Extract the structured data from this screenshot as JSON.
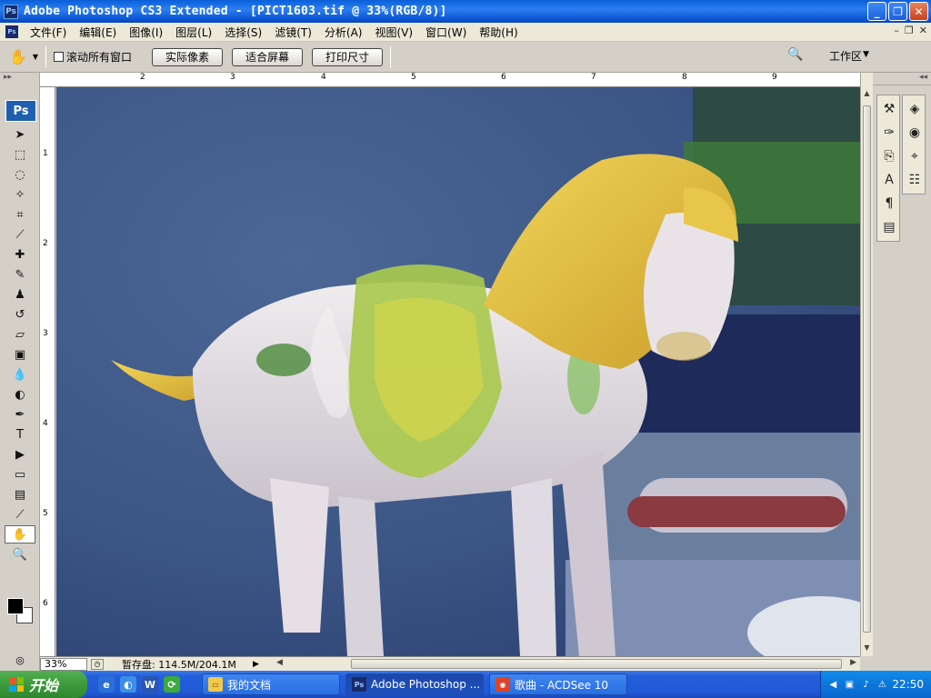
{
  "window": {
    "title": "Adobe Photoshop CS3 Extended - [PICT1603.tif @ 33%(RGB/8)]"
  },
  "menu": {
    "items": [
      "文件(F)",
      "编辑(E)",
      "图像(I)",
      "图层(L)",
      "选择(S)",
      "滤镜(T)",
      "分析(A)",
      "视图(V)",
      "窗口(W)",
      "帮助(H)"
    ]
  },
  "options": {
    "scroll_all_label": "滚动所有窗口",
    "actual_pixels": "实际像素",
    "fit_screen": "适合屏幕",
    "print_size": "打印尺寸",
    "workspace": "工作区"
  },
  "ruler": {
    "h_ticks": [
      "2",
      "3",
      "4",
      "5",
      "6",
      "7",
      "8",
      "9"
    ],
    "v_ticks": [
      "1",
      "2",
      "3",
      "4",
      "5",
      "6"
    ]
  },
  "status": {
    "zoom": "33%",
    "scratch": "暂存盘: 114.5M/204.1M"
  },
  "taskbar": {
    "start": "开始",
    "tasks": [
      {
        "label": "我的文档"
      },
      {
        "label": "Adobe Photoshop ..."
      },
      {
        "label": "歌曲 - ACDSee 10"
      }
    ],
    "clock": "22:50"
  },
  "colors": {
    "titlebar": "#0a5fd8",
    "start_green": "#3c9a3c",
    "photo_bg": "#3f5a8a",
    "horse_yellow": "#e6c640",
    "horse_white": "#e8e2e6",
    "glaze_green": "#8fc44a"
  },
  "icons": {
    "tools": [
      "move-icon",
      "marquee-icon",
      "lasso-icon",
      "magic-wand-icon",
      "crop-icon",
      "eyedropper-icon",
      "healing-icon",
      "brush-icon",
      "stamp-icon",
      "history-brush-icon",
      "eraser-icon",
      "gradient-icon",
      "blur-icon",
      "dodge-icon",
      "pen-icon",
      "type-icon",
      "path-select-icon",
      "shape-icon",
      "notes-icon",
      "color-sampler-icon",
      "hand-icon",
      "zoom-icon"
    ]
  }
}
